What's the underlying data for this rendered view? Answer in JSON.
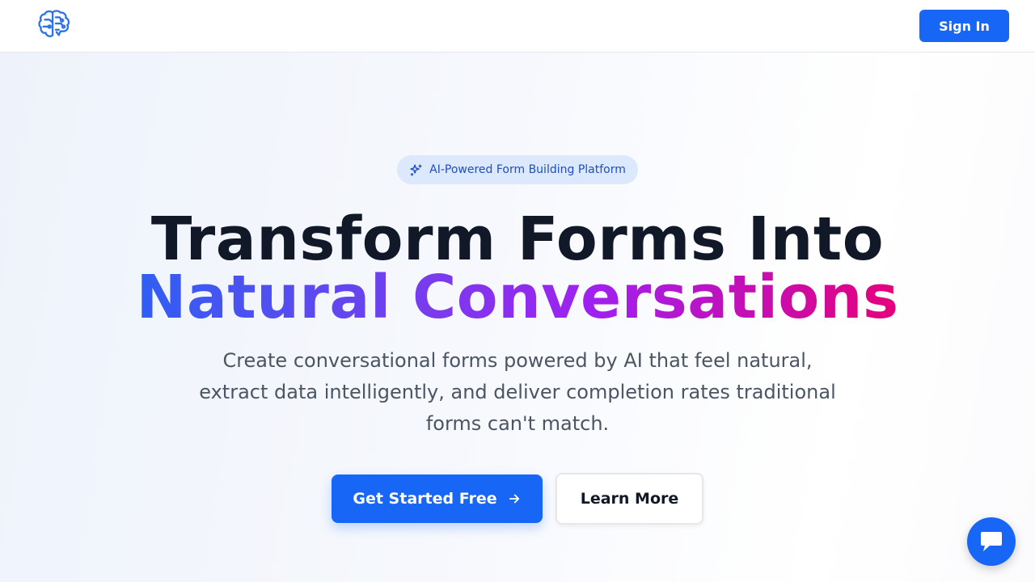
{
  "header": {
    "logo_icon": "brain-circuit-icon",
    "signin_label": "Sign In"
  },
  "hero": {
    "badge_icon": "sparkles-icon",
    "badge_text": "AI-Powered Form Building Platform",
    "title_line1": "Transform Forms Into",
    "title_line2": "Natural Conversations",
    "subtitle": "Create conversational forms powered by AI that feel natural, extract data intelligently, and deliver completion rates traditional forms can't match.",
    "cta_primary_label": "Get Started Free",
    "cta_primary_icon": "arrow-right-icon",
    "cta_secondary_label": "Learn More"
  },
  "chat_widget": {
    "icon": "chat-icon"
  },
  "colors": {
    "accent": "#1766f5",
    "gradient_start": "#2f5ff3",
    "gradient_mid": "#a020f0",
    "gradient_end": "#e6007a",
    "title_text": "#111827"
  }
}
